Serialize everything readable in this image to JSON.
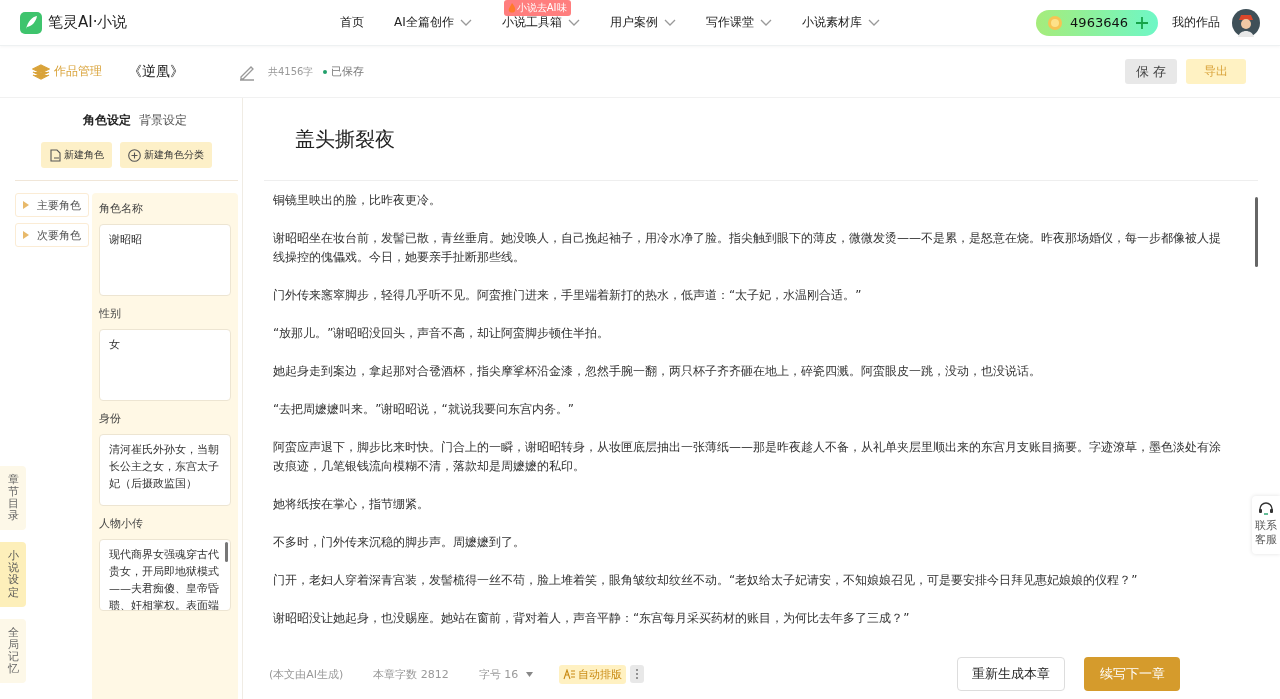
{
  "brand": {
    "name": "笔灵AI·小说"
  },
  "nav": [
    {
      "label": "首页",
      "dropdown": false
    },
    {
      "label": "AI全篇创作",
      "dropdown": true
    },
    {
      "label": "小说工具箱",
      "dropdown": true,
      "badge": "小说去AI味"
    },
    {
      "label": "用户案例",
      "dropdown": true
    },
    {
      "label": "写作课堂",
      "dropdown": true
    },
    {
      "label": "小说素材库",
      "dropdown": true
    }
  ],
  "credits": {
    "value": "4963646"
  },
  "my_works": "我的作品",
  "toolbar": {
    "manage": "作品管理",
    "book_title": "《逆凰》",
    "word_count": "共4156字",
    "save_status": "已保存",
    "save_button": "保 存",
    "export_button": "导出"
  },
  "rail_tabs": [
    {
      "label": "章节目录",
      "selected": false
    },
    {
      "label": "小说设定",
      "selected": true
    },
    {
      "label": "全局记忆",
      "selected": false
    }
  ],
  "settings_tabs": [
    {
      "label": "角色设定",
      "selected": true
    },
    {
      "label": "背景设定",
      "selected": false
    }
  ],
  "settings_buttons": [
    {
      "kind": "file",
      "label": "新建角色"
    },
    {
      "kind": "plus",
      "label": "新建角色分类"
    }
  ],
  "character_groups": [
    {
      "label": "主要角色",
      "expanded": false
    },
    {
      "label": "次要角色",
      "expanded": false
    }
  ],
  "character_fields": [
    {
      "label": "角色名称",
      "value": "谢昭昭"
    },
    {
      "label": "性别",
      "value": "女"
    },
    {
      "label": "身份",
      "value": "清河崔氏外孙女，当朝长公主之女，东宫太子妃（后摄政监国）"
    },
    {
      "label": "人物小传",
      "value": "现代商界女强魂穿古代贵女，开局即地狱模式——夫君痴傻、皇帝昏聩、奸相掌权。表面端"
    }
  ],
  "chapter": {
    "title": "盖头撕裂夜",
    "paragraphs": [
      "铜镜里映出的脸，比昨夜更冷。",
      "谢昭昭坐在妆台前，发髻已散，青丝垂肩。她没唤人，自己挽起袖子，用冷水净了脸。指尖触到眼下的薄皮，微微发烫——不是累，是怒意在烧。昨夜那场婚仪，每一步都像被人提线操控的傀儡戏。今日，她要亲手扯断那些线。",
      "门外传来窸窣脚步，轻得几乎听不见。阿蛮推门进来，手里端着新打的热水，低声道：“太子妃，水温刚合适。”",
      "“放那儿。”谢昭昭没回头，声音不高，却让阿蛮脚步顿住半拍。",
      "她起身走到案边，拿起那对合卺酒杯，指尖摩挲杯沿金漆，忽然手腕一翻，两只杯子齐齐砸在地上，碎瓷四溅。阿蛮眼皮一跳，没动，也没说话。",
      "“去把周嬷嬷叫来。”谢昭昭说，“就说我要问东宫内务。”",
      "阿蛮应声退下，脚步比来时快。门合上的一瞬，谢昭昭转身，从妆匣底层抽出一张薄纸——那是昨夜趁人不备，从礼单夹层里顺出来的东宫月支账目摘要。字迹潦草，墨色淡处有涂改痕迹，几笔银钱流向模糊不清，落款却是周嬷嬷的私印。",
      "她将纸按在掌心，指节绷紧。",
      "不多时，门外传来沉稳的脚步声。周嬷嬷到了。",
      "门开，老妇人穿着深青宫装，发髻梳得一丝不苟，脸上堆着笑，眼角皱纹却纹丝不动。“老奴给太子妃请安，不知娘娘召见，可是要安排今日拜见惠妃娘娘的仪程？”",
      "谢昭昭没让她起身，也没赐座。她站在窗前，背对着人，声音平静：“东宫每月采买药材的账目，为何比去年多了三成？”"
    ]
  },
  "footer": {
    "note": "(本文由AI生成)",
    "chapter_count": "本章字数 2812",
    "font_size": "字号 16",
    "auto_layout": "自动排版",
    "regenerate": "重新生成本章",
    "continue": "续写下一章"
  },
  "support": "联系客服"
}
